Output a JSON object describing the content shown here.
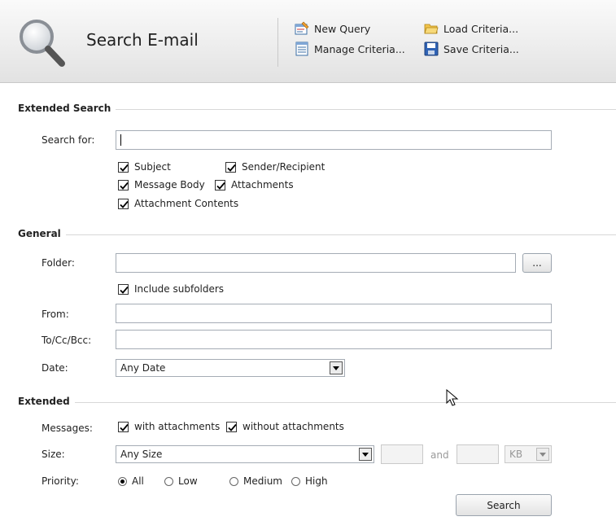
{
  "header": {
    "title": "Search E-mail",
    "toolbar": {
      "new_query": "New Query",
      "manage_criteria": "Manage Criteria...",
      "load_criteria": "Load Criteria...",
      "save_criteria": "Save Criteria..."
    },
    "icons": [
      "magnifier-icon",
      "new-query-icon",
      "manage-criteria-icon",
      "load-folder-icon",
      "save-disk-icon"
    ]
  },
  "extended_search": {
    "heading": "Extended Search",
    "search_for_label": "Search for:",
    "search_value": "",
    "checkboxes": [
      {
        "label": "Subject",
        "checked": true
      },
      {
        "label": "Sender/Recipient",
        "checked": true
      },
      {
        "label": "Message Body",
        "checked": true
      },
      {
        "label": "Attachments",
        "checked": true
      },
      {
        "label": "Attachment Contents",
        "checked": true
      }
    ]
  },
  "general": {
    "heading": "General",
    "folder_label": "Folder:",
    "folder_value": "",
    "browse_label": "...",
    "include_subfolders": {
      "label": "Include subfolders",
      "checked": true
    },
    "from_label": "From:",
    "from_value": "",
    "tocc_label": "To/Cc/Bcc:",
    "tocc_value": "",
    "date_label": "Date:",
    "date_value": "Any Date"
  },
  "extended": {
    "heading": "Extended",
    "messages_label": "Messages:",
    "with_attachments": {
      "label": "with attachments",
      "checked": true
    },
    "without_attachments": {
      "label": "without attachments",
      "checked": true
    },
    "size_label": "Size:",
    "size_value": "Any Size",
    "and_label": "and",
    "unit_value": "KB",
    "priority_label": "Priority:",
    "priority_options": [
      {
        "label": "All",
        "selected": true
      },
      {
        "label": "Low",
        "selected": false
      },
      {
        "label": "Medium",
        "selected": false
      },
      {
        "label": "High",
        "selected": false
      }
    ]
  },
  "search_button": "Search"
}
